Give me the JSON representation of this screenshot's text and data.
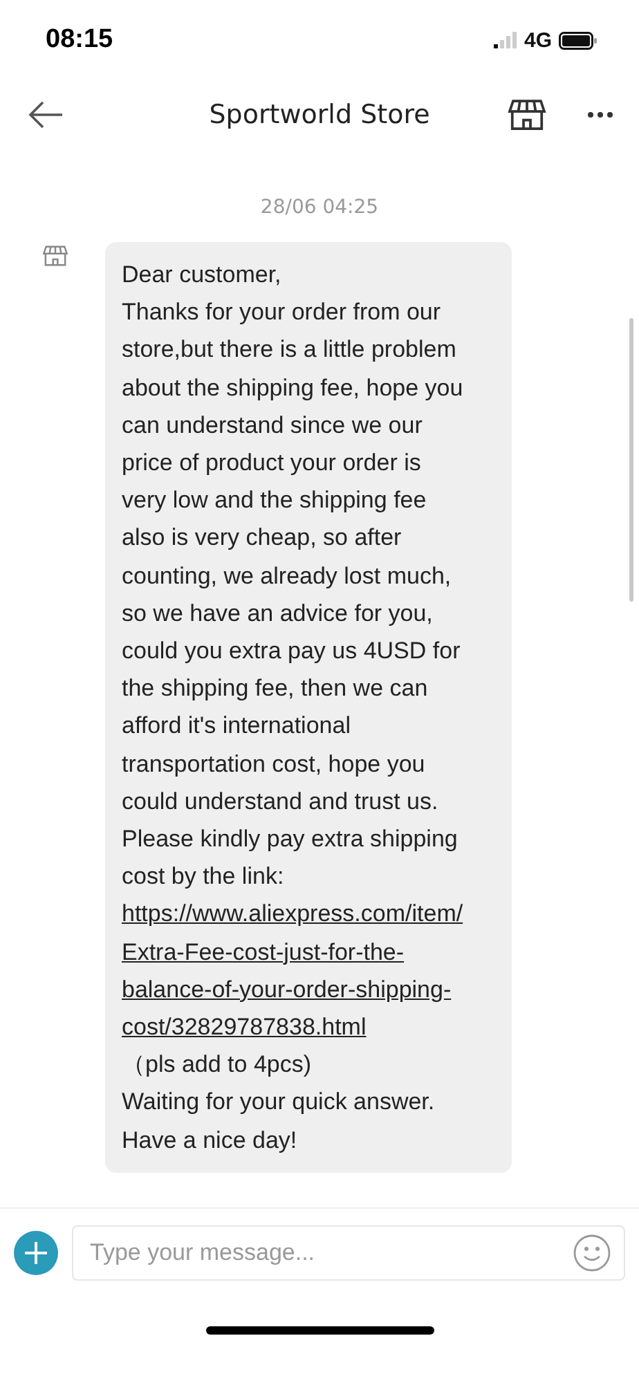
{
  "status_bar": {
    "time": "08:15",
    "network": "4G"
  },
  "header": {
    "title": "Sportworld Store"
  },
  "chat": {
    "timestamp": "28/06 04:25",
    "message": {
      "text_before": "Dear customer,\nThanks for your order from our store,but there is a little problem about the shipping fee, hope you can understand since we our price of product your order is very low and the shipping fee also is very cheap, so after counting, we already lost much, so we have an advice for you, could you extra pay us 4USD for the shipping fee, then we can afford it's international transportation cost, hope you could understand and trust us.\nPlease kindly pay extra shipping cost by the link: ",
      "link": "https://www.aliexpress.com/item/Extra-Fee-cost-just-for-the-balance-of-your-order-shipping-cost/32829787838.html",
      "text_after": "（pls add to 4pcs)\nWaiting for your quick answer.\nHave a nice day!"
    }
  },
  "composer": {
    "placeholder": "Type your message..."
  }
}
